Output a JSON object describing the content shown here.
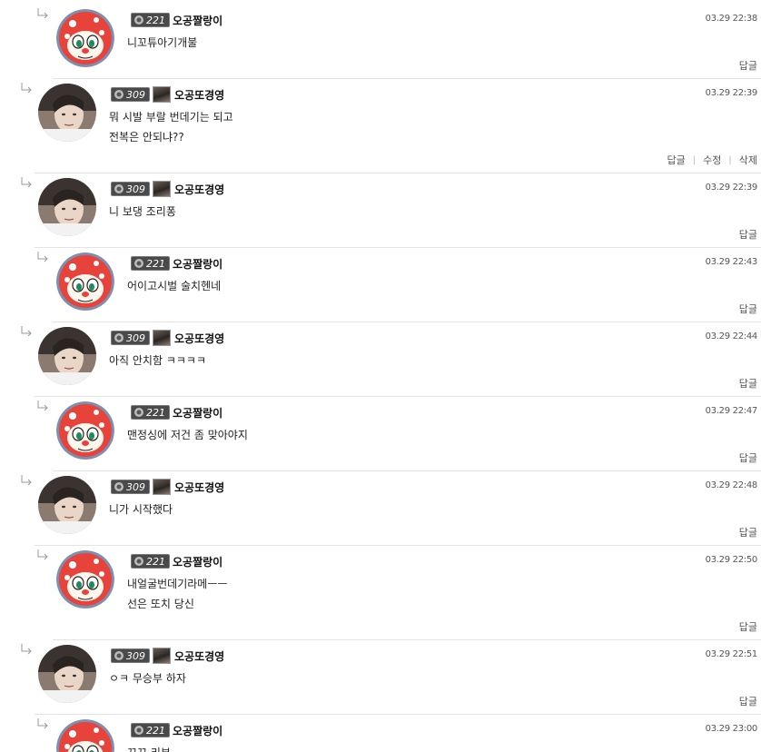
{
  "users": {
    "a": {
      "nickname": "오공짤랑이",
      "level": "221"
    },
    "b": {
      "nickname": "오공또경영",
      "level": "309"
    }
  },
  "labels": {
    "reply": "답글",
    "edit": "수정",
    "delete": "삭제"
  },
  "comments": [
    {
      "user": "오공짤랑이",
      "level": "221",
      "time": "03.29 22:38",
      "lines": [
        "니꼬튜아기개불"
      ]
    },
    {
      "user": "오공또경영",
      "level": "309",
      "time": "03.29 22:39",
      "lines": [
        "뭐 시발 부랄 번데기는 되고",
        "전복은 안되냐??"
      ]
    },
    {
      "user": "오공또경영",
      "level": "309",
      "time": "03.29 22:39",
      "lines": [
        "니 보댕 조리퐁"
      ]
    },
    {
      "user": "오공짤랑이",
      "level": "221",
      "time": "03.29 22:43",
      "lines": [
        "어이고시벌 술치헨네"
      ]
    },
    {
      "user": "오공또경영",
      "level": "309",
      "time": "03.29 22:44",
      "lines": [
        "아직 안치함 ㅋㅋㅋㅋ"
      ]
    },
    {
      "user": "오공짤랑이",
      "level": "221",
      "time": "03.29 22:47",
      "lines": [
        "맨정싱에 저건 좀 맞아야지"
      ]
    },
    {
      "user": "오공또경영",
      "level": "309",
      "time": "03.29 22:48",
      "lines": [
        "니가 시작했다"
      ]
    },
    {
      "user": "오공짤랑이",
      "level": "221",
      "time": "03.29 22:50",
      "lines": [
        "내얼굴번데기라메ㅡㅡ",
        "선은 또치 당신"
      ]
    },
    {
      "user": "오공또경영",
      "level": "309",
      "time": "03.29 22:51",
      "lines": [
        "ㅇㅋ 무승부 하자"
      ]
    },
    {
      "user": "오공짤랑이",
      "level": "221",
      "time": "03.29 23:00",
      "lines": [
        "꼬꼬 리부"
      ]
    }
  ]
}
